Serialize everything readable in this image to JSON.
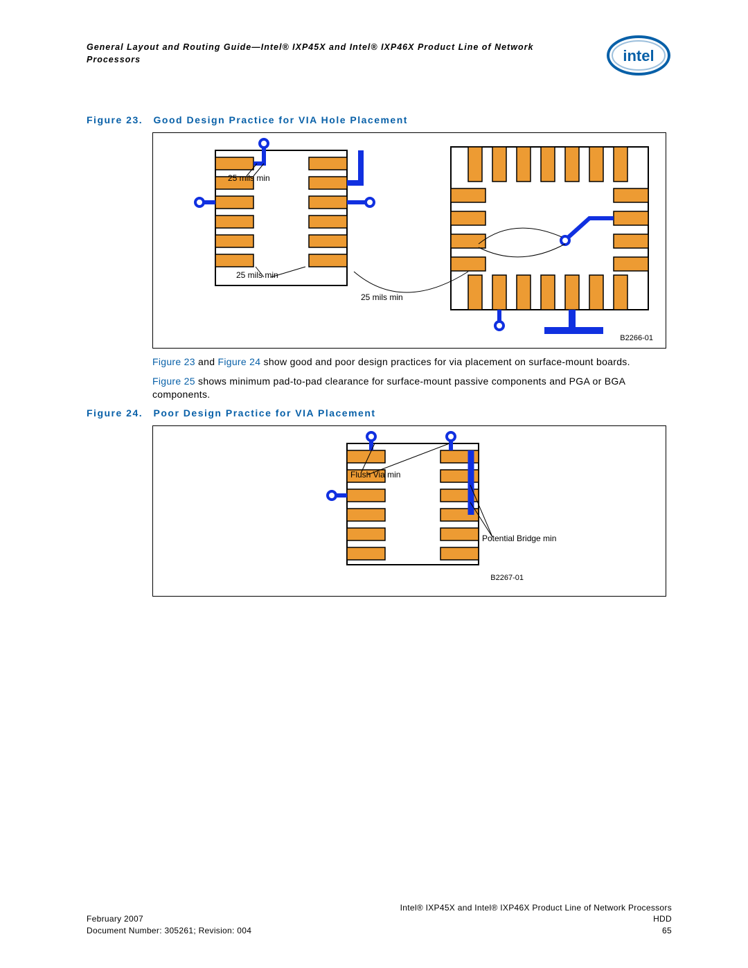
{
  "header": {
    "title_line1": "General Layout and Routing Guide—Intel® IXP45X and Intel® IXP46X Product Line of Network",
    "title_line2": "Processors"
  },
  "figure23": {
    "label": "Figure 23.",
    "title": "Good Design Practice for VIA Hole Placement",
    "annot1": "25 mils min",
    "annot2": "25 mils min",
    "annot3": "25 mils min",
    "drawing_id": "B2266-01"
  },
  "para1": {
    "ref1": "Figure 23",
    "mid1": " and ",
    "ref2": "Figure 24",
    "rest": " show good and poor design practices for via placement on surface-mount boards."
  },
  "para2": {
    "ref1": "Figure 25",
    "rest": " shows minimum pad-to-pad clearance for surface-mount passive components and PGA or BGA components."
  },
  "figure24": {
    "label": "Figure 24.",
    "title": "Poor Design Practice for VIA Placement",
    "annot1": "Flush Via min",
    "annot2": "Potential Bridge min",
    "drawing_id": "B2267-01"
  },
  "footer": {
    "right_title": "Intel® IXP45X and Intel® IXP46X Product Line of Network Processors",
    "left1": "February 2007",
    "right1": "HDD",
    "left2": "Document Number: 305261; Revision: 004",
    "right2": "65"
  }
}
